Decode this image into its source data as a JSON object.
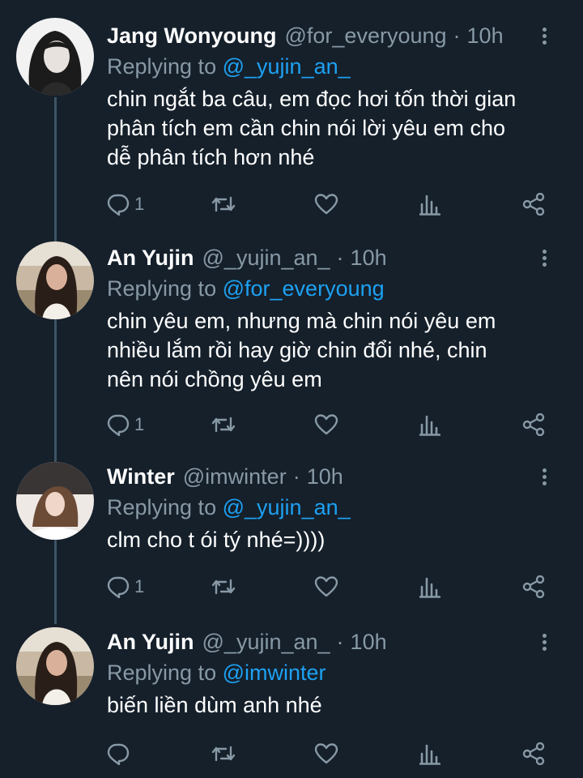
{
  "tweets": [
    {
      "name": "Jang Wonyoung",
      "handle": "@for_everyoung",
      "dot": "·",
      "time": "10h",
      "replying_prefix": "Replying to",
      "replying_to": "@_yujin_an_",
      "text": "chin ngắt ba câu, em đọc hơi tốn thời gian\nphân tích em cần chin nói lời yêu em cho\ndễ phân tích hơn nhé",
      "reply_count": "1"
    },
    {
      "name": "An Yujin",
      "handle": "@_yujin_an_",
      "dot": "·",
      "time": "10h",
      "replying_prefix": "Replying to",
      "replying_to": "@for_everyoung",
      "text": "chin yêu em, nhưng mà chin nói yêu em\nnhiều lắm rồi hay giờ chin đổi nhé, chin\nnên nói chồng yêu em",
      "reply_count": "1"
    },
    {
      "name": "Winter",
      "handle": "@imwinter",
      "dot": "·",
      "time": "10h",
      "replying_prefix": "Replying to",
      "replying_to": "@_yujin_an_",
      "text": "clm cho t ói tý nhé=))))",
      "reply_count": "1"
    },
    {
      "name": "An Yujin",
      "handle": "@_yujin_an_",
      "dot": "·",
      "time": "10h",
      "replying_prefix": "Replying to",
      "replying_to": "@imwinter",
      "text": "biến liền dùm anh nhé",
      "reply_count": ""
    }
  ],
  "icons": {
    "reply": "reply-icon",
    "retweet": "retweet-icon",
    "like": "heart-icon",
    "analytics": "analytics-icon",
    "share": "share-icon",
    "more": "more-vertical-icon"
  },
  "colors": {
    "background": "#15202b",
    "text": "#ffffff",
    "secondary": "#8899a6",
    "accent": "#1da1f2",
    "thread_line": "#3d5466"
  }
}
